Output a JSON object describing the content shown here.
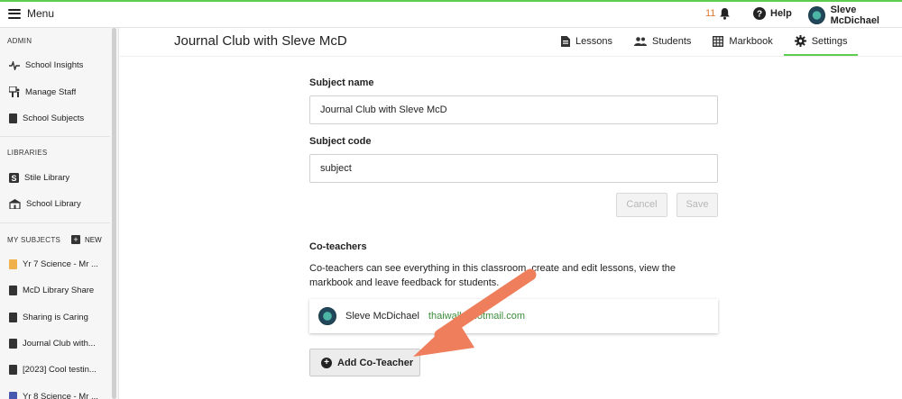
{
  "topbar": {
    "menu_label": "Menu",
    "notification_count": "11",
    "help_label": "Help",
    "user_name": "Sleve McDichael"
  },
  "sidebar": {
    "admin_heading": "ADMIN",
    "admin_items": [
      "School Insights",
      "Manage Staff",
      "School Subjects"
    ],
    "libraries_heading": "LIBRARIES",
    "library_items": [
      "Stile Library",
      "School Library"
    ],
    "subjects_heading": "MY SUBJECTS",
    "new_label": "NEW",
    "subject_items": [
      "Yr 7 Science - Mr ...",
      "McD Library Share",
      "Sharing is Caring",
      "Journal Club with...",
      "[2023] Cool testin...",
      "Yr 8 Science - Mr ..."
    ]
  },
  "page": {
    "title": "Journal Club with Sleve McD",
    "tabs": [
      "Lessons",
      "Students",
      "Markbook",
      "Settings"
    ]
  },
  "form": {
    "subject_name_label": "Subject name",
    "subject_name_value": "Journal Club with Sleve McD",
    "subject_code_label": "Subject code",
    "subject_code_value": "subject",
    "cancel_label": "Cancel",
    "save_label": "Save"
  },
  "coteachers": {
    "heading": "Co-teachers",
    "description": "Co-teachers can see everything in this classroom, create and edit lessons, view the markbook and leave feedback for students.",
    "teacher_name": "Sleve McDichael",
    "teacher_email": "thaiwall@hotmail.com",
    "add_label": "Add Co-Teacher"
  },
  "colors": {
    "accent": "#5ccd4f",
    "arrow": "#ef7f5c",
    "notification": "#e07a2b",
    "email": "#3a8d3a"
  }
}
